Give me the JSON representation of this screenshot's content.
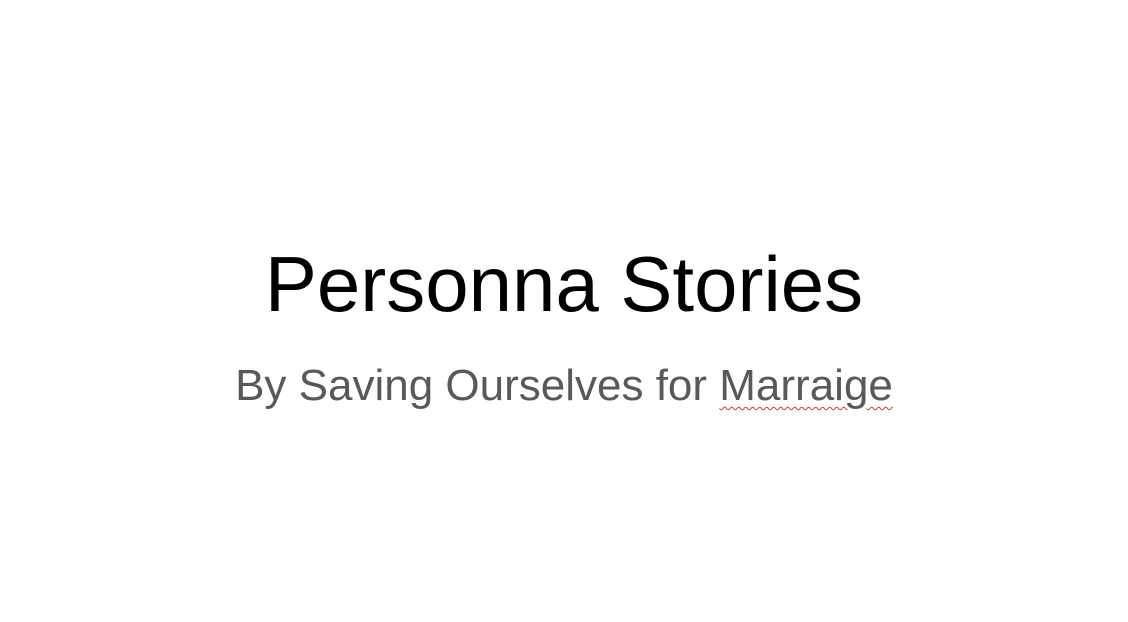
{
  "slide": {
    "title": "Personna Stories",
    "subtitle_prefix": "By Saving Ourselves for ",
    "subtitle_flagged_word": "Marraige"
  },
  "colors": {
    "background": "#ffffff",
    "title": "#000000",
    "subtitle": "#595959",
    "spellcheck_underline": "#e03030"
  }
}
